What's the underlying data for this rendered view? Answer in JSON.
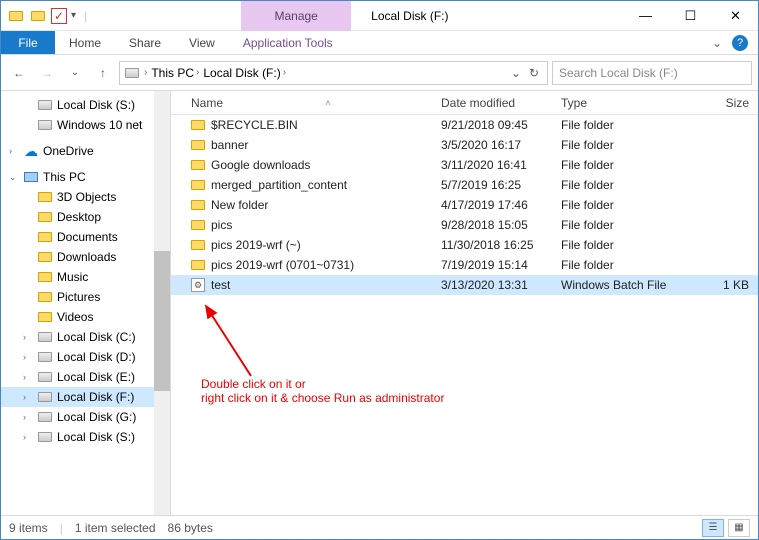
{
  "window": {
    "title": "Local Disk (F:)",
    "context_tab": "Manage",
    "context_group": "Application Tools"
  },
  "ribbon": {
    "file": "File",
    "tabs": [
      "Home",
      "Share",
      "View"
    ]
  },
  "breadcrumb": {
    "parts": [
      "This PC",
      "Local Disk (F:)"
    ]
  },
  "search": {
    "placeholder": "Search Local Disk (F:)"
  },
  "sidebar": {
    "local_s": "Local Disk (S:)",
    "win10net": "Windows 10 net",
    "onedrive": "OneDrive",
    "thispc": "This PC",
    "children": [
      "3D Objects",
      "Desktop",
      "Documents",
      "Downloads",
      "Music",
      "Pictures",
      "Videos",
      "Local Disk (C:)",
      "Local Disk (D:)",
      "Local Disk (E:)",
      "Local Disk (F:)",
      "Local Disk (G:)",
      "Local Disk (S:)"
    ]
  },
  "columns": {
    "name": "Name",
    "date": "Date modified",
    "type": "Type",
    "size": "Size"
  },
  "rows": [
    {
      "name": "$RECYCLE.BIN",
      "date": "9/21/2018 09:45",
      "type": "File folder",
      "size": "",
      "kind": "folder"
    },
    {
      "name": "banner",
      "date": "3/5/2020 16:17",
      "type": "File folder",
      "size": "",
      "kind": "folder"
    },
    {
      "name": "Google downloads",
      "date": "3/11/2020 16:41",
      "type": "File folder",
      "size": "",
      "kind": "folder"
    },
    {
      "name": "merged_partition_content",
      "date": "5/7/2019 16:25",
      "type": "File folder",
      "size": "",
      "kind": "folder"
    },
    {
      "name": "New folder",
      "date": "4/17/2019 17:46",
      "type": "File folder",
      "size": "",
      "kind": "folder"
    },
    {
      "name": "pics",
      "date": "9/28/2018 15:05",
      "type": "File folder",
      "size": "",
      "kind": "folder"
    },
    {
      "name": "pics 2019-wrf (~)",
      "date": "11/30/2018 16:25",
      "type": "File folder",
      "size": "",
      "kind": "folder"
    },
    {
      "name": "pics 2019-wrf (0701~0731)",
      "date": "7/19/2019 15:14",
      "type": "File folder",
      "size": "",
      "kind": "folder"
    },
    {
      "name": "test",
      "date": "3/13/2020 13:31",
      "type": "Windows Batch File",
      "size": "1 KB",
      "kind": "batch",
      "selected": true
    }
  ],
  "status": {
    "items": "9 items",
    "selection": "1 item selected",
    "size": "86 bytes"
  },
  "annotation": {
    "line1": "Double click on it or",
    "line2": "right click on it & choose Run as administrator"
  }
}
